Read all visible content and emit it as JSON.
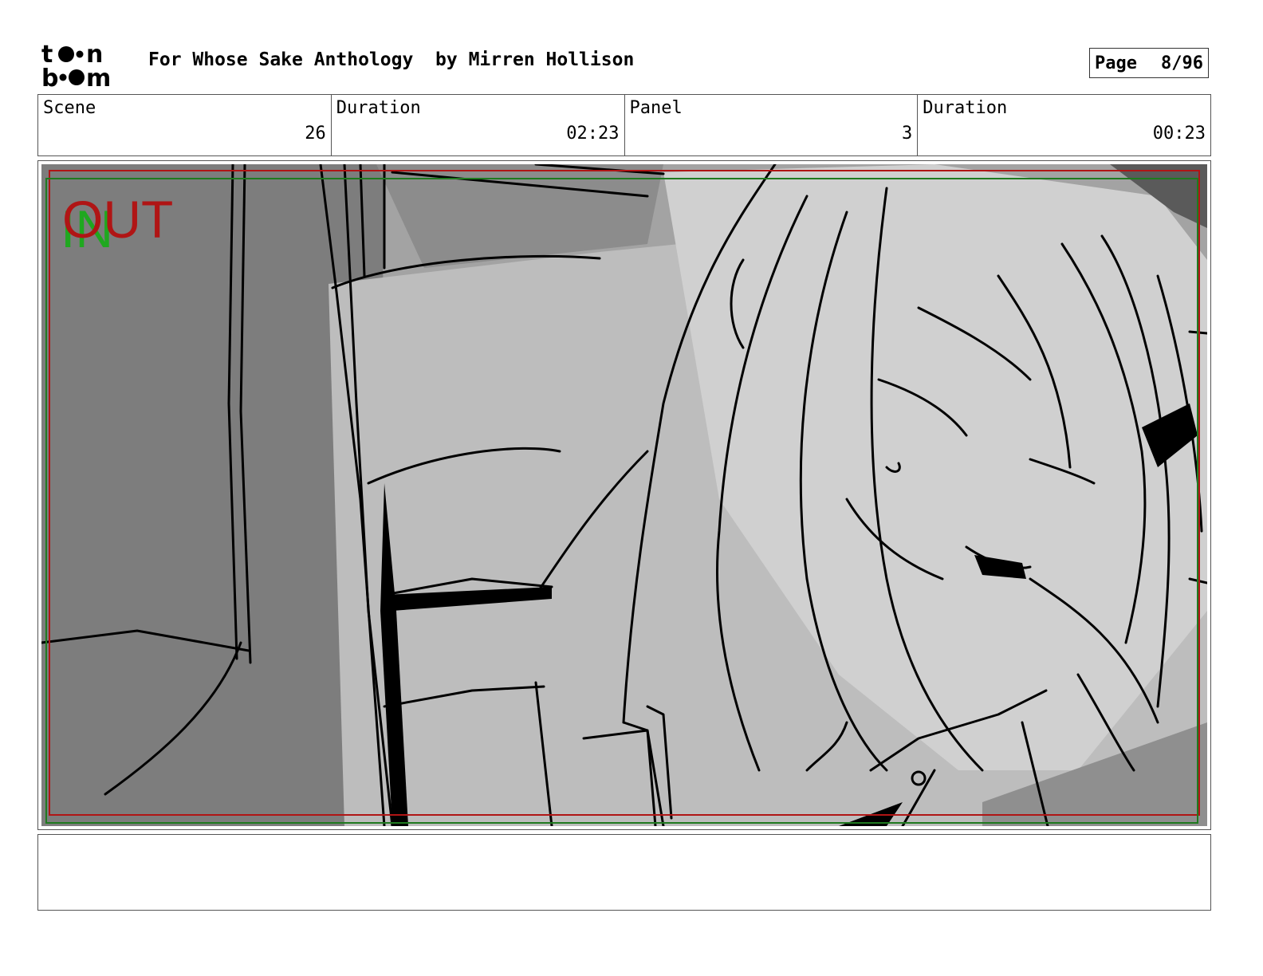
{
  "header": {
    "logo_text": "toon boom",
    "title": "For Whose Sake Anthology",
    "author": "by Mirren Hollison",
    "page_label": "Page",
    "page_value": "8/96"
  },
  "info": {
    "scene_label": "Scene",
    "scene_value": "26",
    "scene_duration_label": "Duration",
    "scene_duration_value": "02:23",
    "panel_label": "Panel",
    "panel_value": "3",
    "panel_duration_label": "Duration",
    "panel_duration_value": "00:23"
  },
  "panel": {
    "in_label": "IN",
    "out_label": "OUT",
    "in_color": "#1fa81f",
    "out_color": "#b01515"
  },
  "notes": {
    "text": ""
  }
}
